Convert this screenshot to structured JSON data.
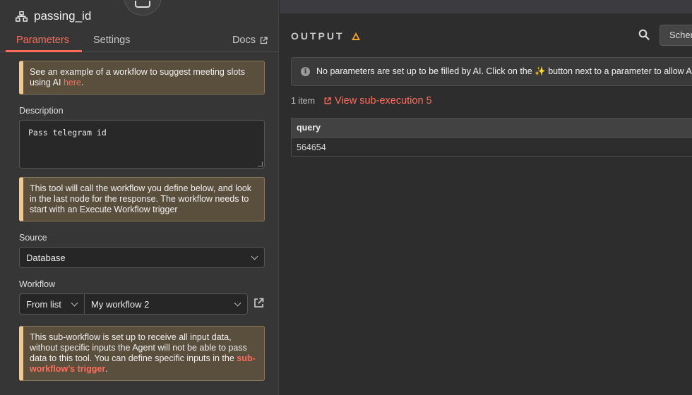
{
  "node": {
    "title": "passing_id",
    "icon": "sitemap-icon"
  },
  "tabs": [
    {
      "label": "Parameters",
      "active": true
    },
    {
      "label": "Settings",
      "active": false
    }
  ],
  "docs_label": "Docs",
  "callouts": {
    "example": {
      "text": "See an example of a workflow to suggest meeting slots using AI ",
      "link": "here",
      "suffix": "."
    },
    "tool": {
      "text": "This tool will call the workflow you define below, and look in the last node for the response. The workflow needs to start with an Execute Workflow trigger"
    },
    "subworkflow": {
      "text": "This sub-workflow is set up to receive all input data, without specific inputs the Agent will not be able to pass data to this tool. You can define specific inputs in the ",
      "link": "sub-workflow’s trigger",
      "suffix": "."
    }
  },
  "description": {
    "label": "Description",
    "value": "Pass telegram id"
  },
  "source": {
    "label": "Source",
    "value": "Database"
  },
  "workflow": {
    "label": "Workflow",
    "mode": "From list",
    "value": "My workflow 2"
  },
  "output": {
    "title": "OUTPUT",
    "schema_label": "Schema",
    "info_text": "No parameters are set up to be filled by AI. Click on the ✨ button next to a parameter to allow AI to set that value.",
    "items_count": "1 item",
    "sub_execution_link": "View sub-execution 5",
    "table": {
      "columns": [
        "query"
      ],
      "rows": [
        [
          "564654"
        ]
      ]
    }
  },
  "colors": {
    "accent": "#ff6d5a",
    "warning": "#f5a623",
    "callout_bg": "#5a4e3d"
  }
}
